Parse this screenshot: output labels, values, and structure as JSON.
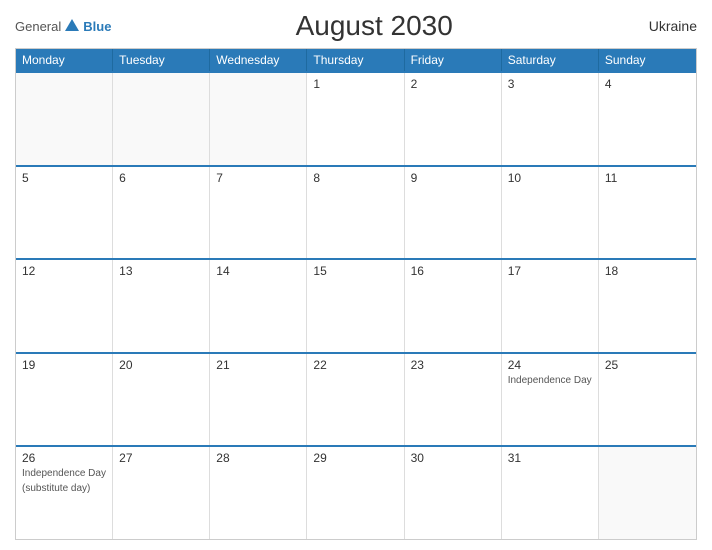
{
  "header": {
    "title": "August 2030",
    "country": "Ukraine",
    "logo_general": "General",
    "logo_blue": "Blue"
  },
  "weekdays": [
    "Monday",
    "Tuesday",
    "Wednesday",
    "Thursday",
    "Friday",
    "Saturday",
    "Sunday"
  ],
  "rows": [
    [
      {
        "day": "",
        "event": ""
      },
      {
        "day": "",
        "event": ""
      },
      {
        "day": "",
        "event": ""
      },
      {
        "day": "1",
        "event": ""
      },
      {
        "day": "2",
        "event": ""
      },
      {
        "day": "3",
        "event": ""
      },
      {
        "day": "4",
        "event": ""
      }
    ],
    [
      {
        "day": "5",
        "event": ""
      },
      {
        "day": "6",
        "event": ""
      },
      {
        "day": "7",
        "event": ""
      },
      {
        "day": "8",
        "event": ""
      },
      {
        "day": "9",
        "event": ""
      },
      {
        "day": "10",
        "event": ""
      },
      {
        "day": "11",
        "event": ""
      }
    ],
    [
      {
        "day": "12",
        "event": ""
      },
      {
        "day": "13",
        "event": ""
      },
      {
        "day": "14",
        "event": ""
      },
      {
        "day": "15",
        "event": ""
      },
      {
        "day": "16",
        "event": ""
      },
      {
        "day": "17",
        "event": ""
      },
      {
        "day": "18",
        "event": ""
      }
    ],
    [
      {
        "day": "19",
        "event": ""
      },
      {
        "day": "20",
        "event": ""
      },
      {
        "day": "21",
        "event": ""
      },
      {
        "day": "22",
        "event": ""
      },
      {
        "day": "23",
        "event": ""
      },
      {
        "day": "24",
        "event": "Independence Day"
      },
      {
        "day": "25",
        "event": ""
      }
    ],
    [
      {
        "day": "26",
        "event": "Independence Day\n(substitute day)"
      },
      {
        "day": "27",
        "event": ""
      },
      {
        "day": "28",
        "event": ""
      },
      {
        "day": "29",
        "event": ""
      },
      {
        "day": "30",
        "event": ""
      },
      {
        "day": "31",
        "event": ""
      },
      {
        "day": "",
        "event": ""
      }
    ]
  ]
}
